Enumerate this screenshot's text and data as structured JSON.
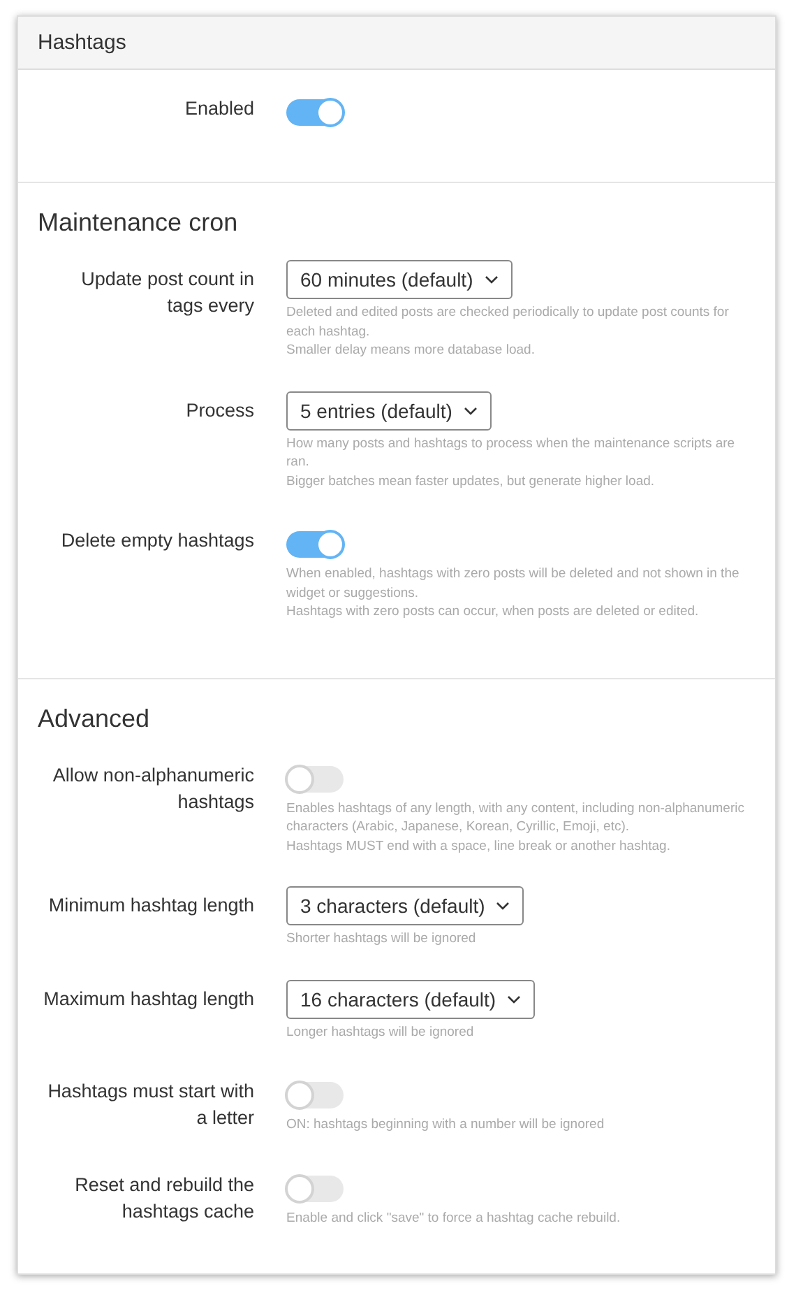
{
  "panel": {
    "title": "Hashtags"
  },
  "sections": [
    {
      "rows": [
        {
          "label": "Enabled",
          "kind": "toggle",
          "on": true
        }
      ]
    },
    {
      "title": "Maintenance cron",
      "rows": [
        {
          "label": "Update post count in tags every",
          "kind": "select",
          "value": "60 minutes (default)",
          "help": [
            "Deleted and edited posts are checked periodically to update post counts for each hashtag.",
            "Smaller delay means more database load."
          ]
        },
        {
          "label": "Process",
          "kind": "select",
          "value": "5 entries (default)",
          "help": [
            "How many posts and hashtags to process when the maintenance scripts are ran.",
            "Bigger batches mean faster updates, but generate higher load."
          ]
        },
        {
          "label": "Delete empty hashtags",
          "kind": "toggle",
          "on": true,
          "help": [
            "When enabled, hashtags with zero posts will be deleted and not shown in the widget or suggestions.",
            "Hashtags with zero posts can occur, when posts are deleted or edited."
          ]
        }
      ]
    },
    {
      "title": "Advanced",
      "rows": [
        {
          "label": "Allow non-alphanumeric hashtags",
          "kind": "toggle",
          "on": false,
          "help": [
            "Enables hashtags of any length, with any content, including non-alphanumeric characters (Arabic, Japanese, Korean, Cyrillic, Emoji, etc).",
            "Hashtags MUST end with a space, line break or another hashtag."
          ]
        },
        {
          "label": "Minimum hashtag length",
          "kind": "select",
          "value": "3 characters (default)",
          "help": [
            "Shorter hashtags will be ignored"
          ]
        },
        {
          "label": "Maximum hashtag length",
          "kind": "select",
          "value": "16 characters (default)",
          "help": [
            "Longer hashtags will be ignored"
          ]
        },
        {
          "label": "Hashtags must start with a letter",
          "kind": "toggle",
          "on": false,
          "help": [
            "ON: hashtags beginning with a number will be ignored"
          ]
        },
        {
          "label": "Reset and rebuild the hashtags cache",
          "kind": "toggle",
          "on": false,
          "help": [
            "Enable and click \"save\" to force a hashtag cache rebuild."
          ]
        }
      ]
    }
  ]
}
